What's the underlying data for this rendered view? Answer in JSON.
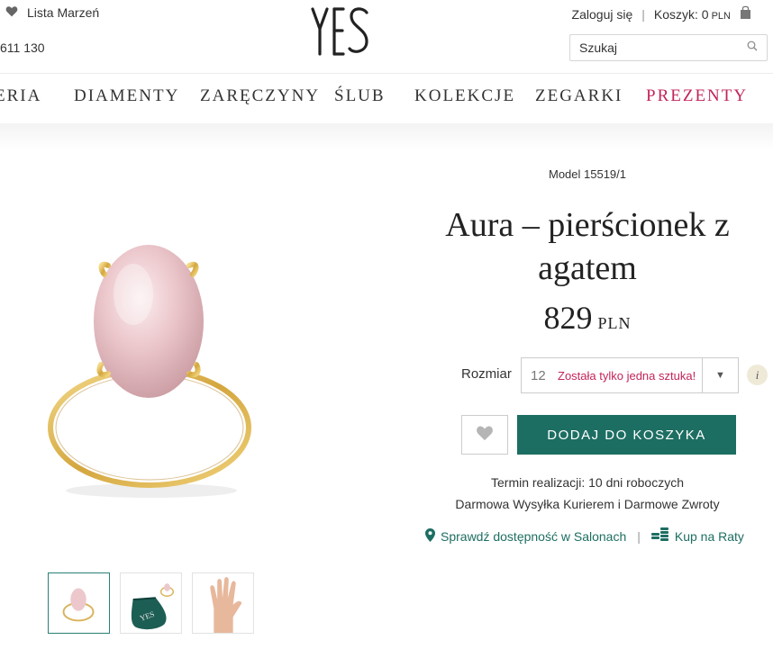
{
  "header": {
    "wishlist_label": "Lista Marzeń",
    "phone": "611 130",
    "logo_text": "YES",
    "login_label": "Zaloguj się",
    "separator": "|",
    "cart_label": "Koszyk: 0",
    "cart_currency": "PLN",
    "search_placeholder": "Szukaj"
  },
  "nav": {
    "items": [
      {
        "label": "ERIA"
      },
      {
        "label": "DIAMENTY"
      },
      {
        "label": "ZARĘCZYNY"
      },
      {
        "label": "ŚLUB"
      },
      {
        "label": "KOLEKCJE"
      },
      {
        "label": "ZEGARKI"
      },
      {
        "label": "PREZENTY"
      }
    ],
    "promo_color": "#c3245b"
  },
  "product": {
    "model": "Model 15519/1",
    "title": "Aura – pierścionek z agatem",
    "price": "829",
    "currency": "PLN",
    "size_label": "Rozmiar",
    "size_value": "12",
    "stock_note": "Została tylko jedna sztuka!",
    "add_to_cart": "DODAJ DO KOSZYKA",
    "delivery_time": "Termin realizacji: 10 dni roboczych",
    "shipping": "Darmowa Wysyłka Kurierem i Darmowe Zwroty",
    "check_stores": "Sprawdź dostępność w Salonach",
    "installments": "Kup na Raty",
    "link_separator": "|",
    "accent_color": "#1d6e62",
    "info_glyph": "i",
    "thumb_pouch_text": "YES"
  }
}
